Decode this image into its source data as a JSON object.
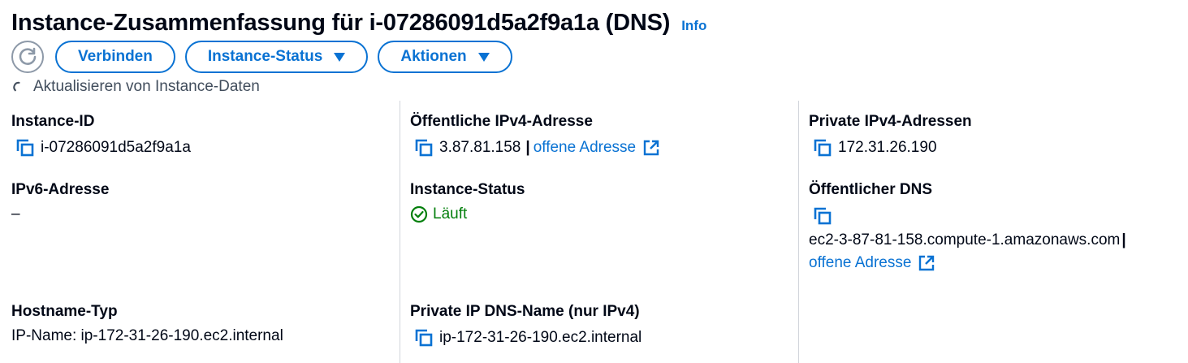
{
  "header": {
    "title": "Instance-Zusammenfassung für i-07286091d5a2f9a1a (DNS)",
    "info": "Info"
  },
  "toolbar": {
    "connect": "Verbinden",
    "instance_status": "Instance-Status",
    "actions": "Aktionen"
  },
  "loading_text": "Aktualisieren von Instance-Daten",
  "fields": {
    "instance_id": {
      "label": "Instance-ID",
      "value": "i-07286091d5a2f9a1a"
    },
    "public_ipv4": {
      "label": "Öffentliche IPv4-Adresse",
      "value": "3.87.81.158",
      "separator": "|",
      "link": "offene Adresse"
    },
    "private_ipv4": {
      "label": "Private IPv4-Adressen",
      "value": "172.31.26.190"
    },
    "ipv6": {
      "label": "IPv6-Adresse",
      "value": "–"
    },
    "instance_state": {
      "label": "Instance-Status",
      "value": "Läuft"
    },
    "public_dns": {
      "label": "Öffentlicher DNS",
      "value": "ec2-3-87-81-158.compute-1.amazonaws.com",
      "separator": "|",
      "link": "offene Adresse"
    },
    "hostname_type": {
      "label": "Hostname-Typ",
      "value": "IP-Name: ip-172-31-26-190.ec2.internal"
    },
    "private_dns": {
      "label": "Private IP DNS-Name (nur IPv4)",
      "value": "ip-172-31-26-190.ec2.internal"
    }
  },
  "colors": {
    "link": "#0972d3",
    "success": "#037f0c",
    "text": "#000716",
    "divider": "#d1d5db"
  },
  "icons": {
    "refresh": "refresh-icon",
    "copy": "copy-icon",
    "external": "external-link-icon",
    "status": "check-circle-icon",
    "loading": "spinner-icon"
  }
}
